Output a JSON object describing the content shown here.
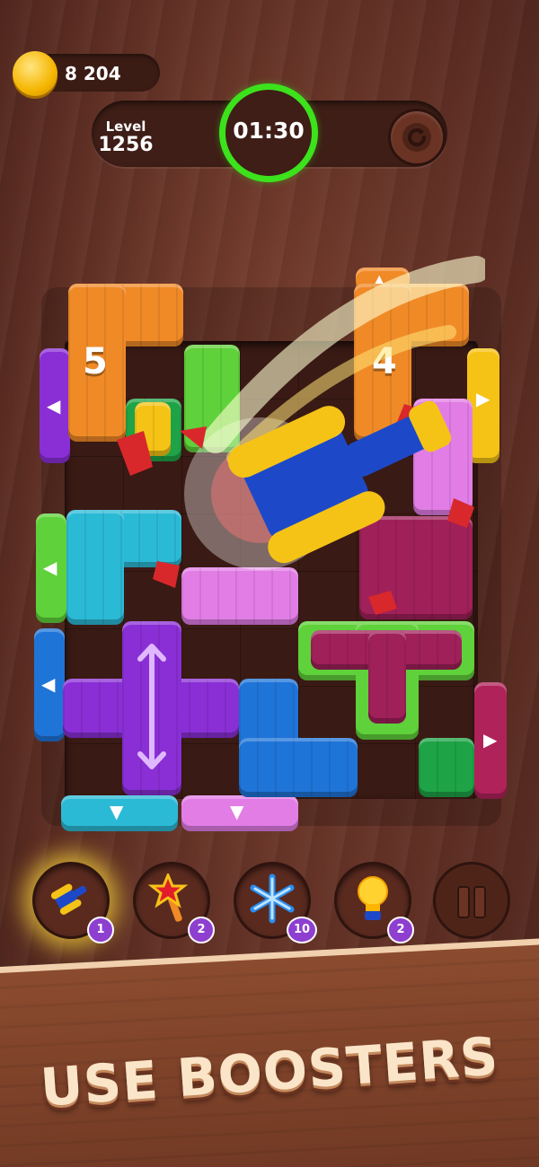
{
  "hud": {
    "coins": "8 204",
    "level_label": "Level",
    "level_number": "1256",
    "timer": "01:30",
    "timer_ring_color": "#3ce21b",
    "restart_icon": "restart-icon"
  },
  "board": {
    "block_counters": [
      "5",
      "4"
    ],
    "colors": {
      "orange": "#f08a27",
      "purple": "#8a2fd6",
      "green": "#5fd13a",
      "cyan": "#2bbad6",
      "pink": "#e27de6",
      "magenta": "#b0225a",
      "blue": "#1f74d8",
      "yellow": "#f5c316",
      "dark_green": "#1ea347"
    }
  },
  "boosters": [
    {
      "icon": "hammer-icon",
      "count": "1",
      "active": true
    },
    {
      "icon": "magic-wand-icon",
      "count": "2",
      "active": false
    },
    {
      "icon": "snowflake-icon",
      "count": "10",
      "active": false
    },
    {
      "icon": "lightbulb-icon",
      "count": "2",
      "active": false
    }
  ],
  "pause_icon": "pause-icon",
  "promo_text": "USE BOOSTERS"
}
